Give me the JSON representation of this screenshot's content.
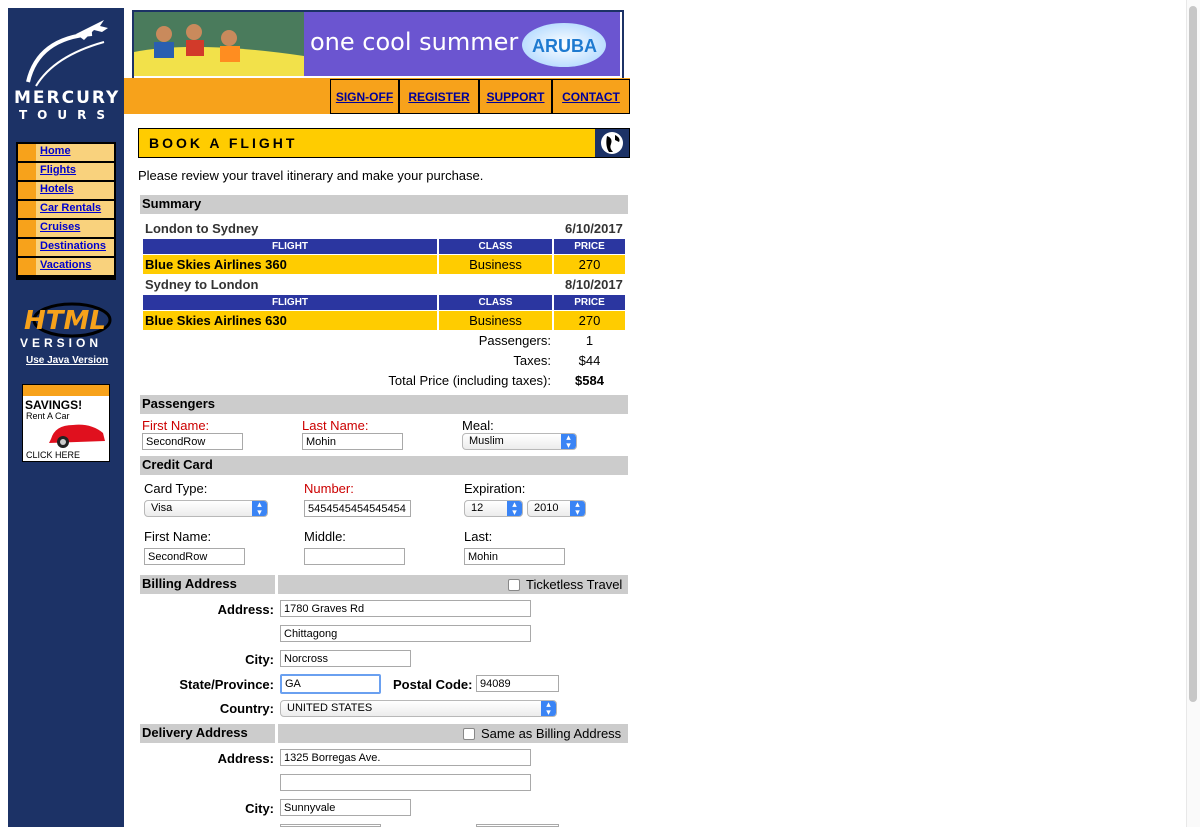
{
  "logo": {
    "line1": "MERCURY",
    "line2": "TOURS"
  },
  "nav": [
    {
      "label": "Home"
    },
    {
      "label": "Flights"
    },
    {
      "label": "Hotels"
    },
    {
      "label": "Car Rentals"
    },
    {
      "label": "Cruises"
    },
    {
      "label": "Destinations"
    },
    {
      "label": "Vacations"
    }
  ],
  "html_version": {
    "line1": "HTML",
    "line2": "VERSION",
    "link": "Use Java Version"
  },
  "savings_ad": {
    "title": "SAVINGS!",
    "sub": "Rent A Car",
    "cta": "CLICK HERE"
  },
  "banner": {
    "text": "one cool summer",
    "brand": "ARUBA"
  },
  "topnav": {
    "signoff": "SIGN-OFF",
    "register": "REGISTER",
    "support": "SUPPORT",
    "contact": "CONTACT"
  },
  "page": {
    "title": "BOOK A FLIGHT",
    "intro": "Please review your travel itinerary and make your purchase."
  },
  "summary": {
    "heading": "Summary",
    "columns": {
      "flight": "FLIGHT",
      "class": "CLASS",
      "price": "PRICE"
    },
    "legs": [
      {
        "route": "London to Sydney",
        "date": "6/10/2017",
        "flight": "Blue Skies Airlines 360",
        "class": "Business",
        "price": "270"
      },
      {
        "route": "Sydney to London",
        "date": "8/10/2017",
        "flight": "Blue Skies Airlines 630",
        "class": "Business",
        "price": "270"
      }
    ],
    "passengers_label": "Passengers:",
    "passengers_value": "1",
    "taxes_label": "Taxes:",
    "taxes_value": "$44",
    "total_label": "Total Price (including taxes):",
    "total_value": "$584"
  },
  "passengers": {
    "heading": "Passengers",
    "first_label": "First Name:",
    "first_value": "SecondRow",
    "last_label": "Last Name:",
    "last_value": "Mohin",
    "meal_label": "Meal:",
    "meal_value": "Muslim"
  },
  "credit_card": {
    "heading": "Credit Card",
    "type_label": "Card Type:",
    "type_value": "Visa",
    "number_label": "Number:",
    "number_value": "5454545454545454",
    "exp_label": "Expiration:",
    "exp_month": "12",
    "exp_year": "2010",
    "first_label": "First Name:",
    "first_value": "SecondRow",
    "middle_label": "Middle:",
    "middle_value": "",
    "last_label": "Last:",
    "last_value": "Mohin"
  },
  "billing": {
    "heading": "Billing Address",
    "ticketless_label": "Ticketless Travel",
    "address_label": "Address:",
    "address1": "1780 Graves Rd",
    "address2": "Chittagong",
    "city_label": "City:",
    "city": "Norcross",
    "state_label": "State/Province:",
    "state": "GA",
    "postal_label": "Postal Code:",
    "postal": "94089",
    "country_label": "Country:",
    "country": "UNITED STATES"
  },
  "delivery": {
    "heading": "Delivery Address",
    "same_label": "Same as Billing Address",
    "address_label": "Address:",
    "address1": "1325 Borregas Ave.",
    "address2": "",
    "city_label": "City:",
    "city": "Sunnyvale"
  },
  "colors": {
    "navy": "#1c3266",
    "orange": "#f7a21b",
    "yellow": "#ffcc00",
    "table_head": "#2b36a0",
    "section_gray": "#cccccc",
    "required_red": "#cc0000"
  }
}
